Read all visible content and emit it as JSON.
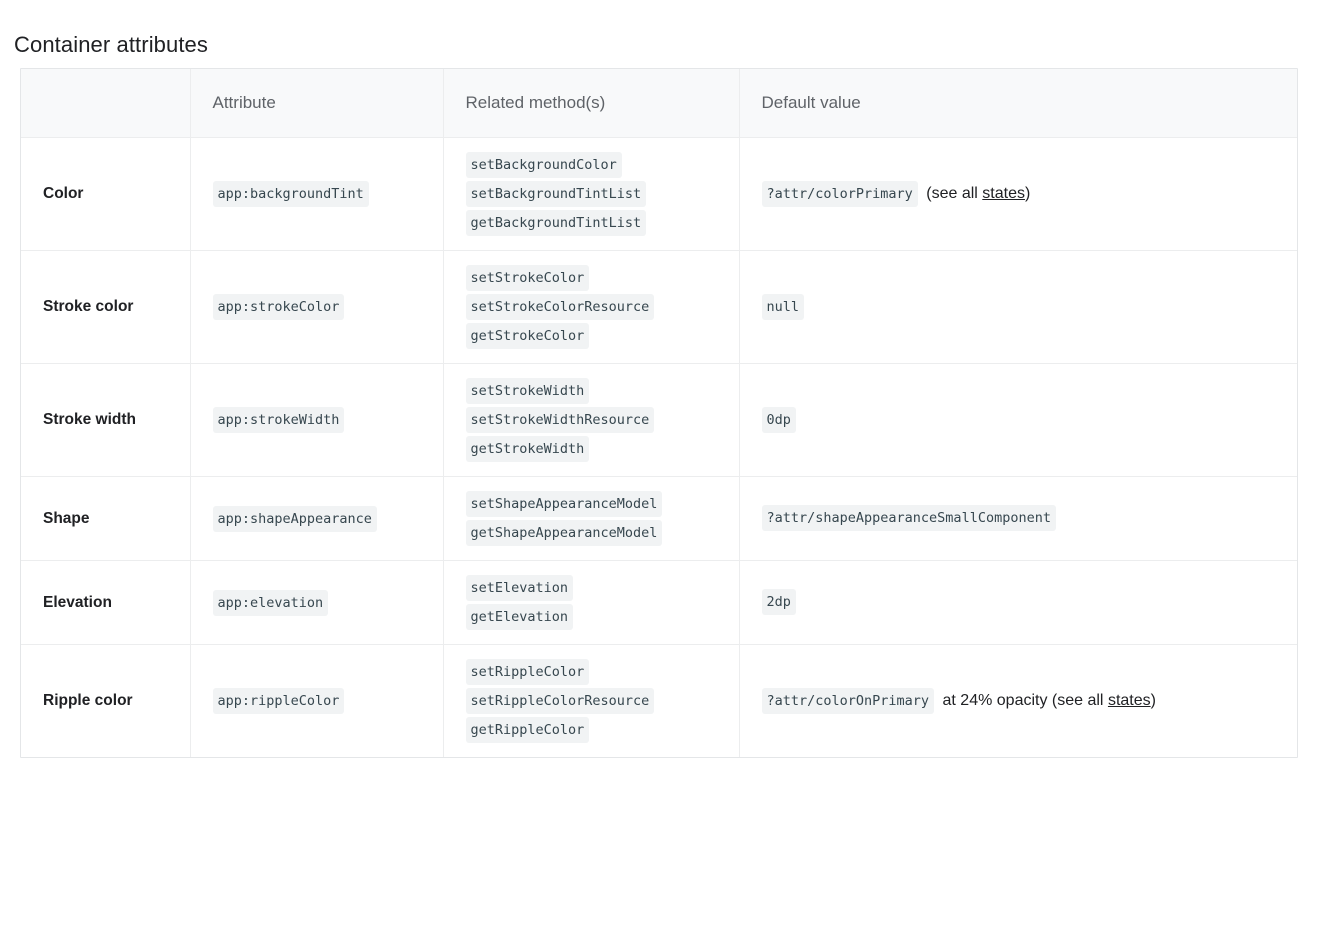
{
  "page_title": "Container attributes",
  "table": {
    "headers": [
      "",
      "Attribute",
      "Related method(s)",
      "Default value"
    ],
    "rows": [
      {
        "label": "Color",
        "attribute": "app:backgroundTint",
        "methods": [
          "setBackgroundColor",
          "setBackgroundTintList",
          "getBackgroundTintList"
        ],
        "default_code": "?attr/colorPrimary",
        "default_prefix": "",
        "default_middle": " (see all ",
        "default_link": "states",
        "default_suffix": ")"
      },
      {
        "label": "Stroke color",
        "attribute": "app:strokeColor",
        "methods": [
          "setStrokeColor",
          "setStrokeColorResource",
          "getStrokeColor"
        ],
        "default_code": "null",
        "default_prefix": "",
        "default_middle": "",
        "default_link": "",
        "default_suffix": ""
      },
      {
        "label": "Stroke width",
        "attribute": "app:strokeWidth",
        "methods": [
          "setStrokeWidth",
          "setStrokeWidthResource",
          "getStrokeWidth"
        ],
        "default_code": "0dp",
        "default_prefix": "",
        "default_middle": "",
        "default_link": "",
        "default_suffix": ""
      },
      {
        "label": "Shape",
        "attribute": "app:shapeAppearance",
        "methods": [
          "setShapeAppearanceModel",
          "getShapeAppearanceModel"
        ],
        "default_code": "?attr/shapeAppearanceSmallComponent",
        "default_prefix": "",
        "default_middle": "",
        "default_link": "",
        "default_suffix": ""
      },
      {
        "label": "Elevation",
        "attribute": "app:elevation",
        "methods": [
          "setElevation",
          "getElevation"
        ],
        "default_code": "2dp",
        "default_prefix": "",
        "default_middle": "",
        "default_link": "",
        "default_suffix": ""
      },
      {
        "label": "Ripple color",
        "attribute": "app:rippleColor",
        "methods": [
          "setRippleColor",
          "setRippleColorResource",
          "getRippleColor"
        ],
        "default_code": "?attr/colorOnPrimary",
        "default_prefix": "",
        "default_middle": " at 24% opacity (see all ",
        "default_link": "states",
        "default_suffix": ")"
      }
    ]
  },
  "colors": {
    "code_chip_bg": "#f1f3f4",
    "header_bg": "#f8f9fa",
    "border": "#ecedee",
    "text": "#202124",
    "header_text": "#5f6368"
  }
}
